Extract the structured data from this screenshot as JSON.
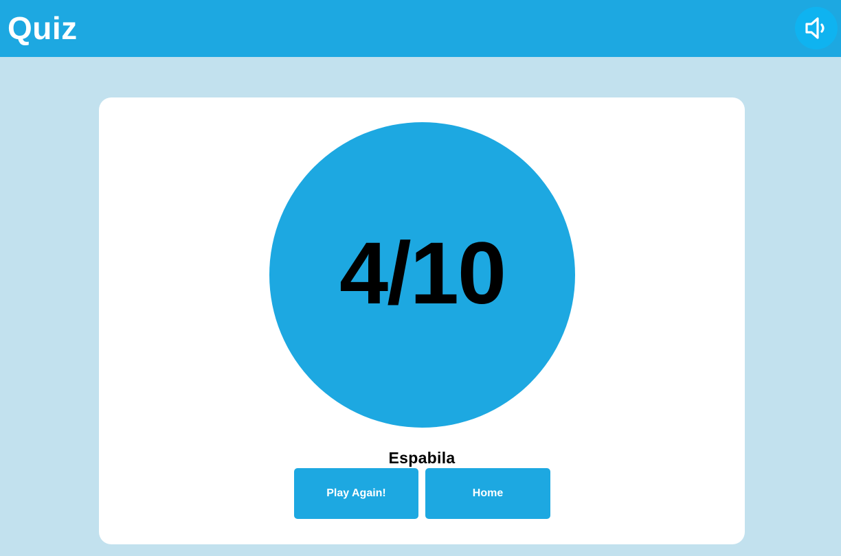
{
  "header": {
    "title": "Quiz",
    "sound_icon": "speaker-icon"
  },
  "result": {
    "score": "4/10",
    "message": "Espabila"
  },
  "actions": {
    "play_again_label": "Play Again!",
    "home_label": "Home"
  },
  "colors": {
    "accent": "#1da8e1",
    "background": "#c2e1ee",
    "card": "#ffffff"
  }
}
